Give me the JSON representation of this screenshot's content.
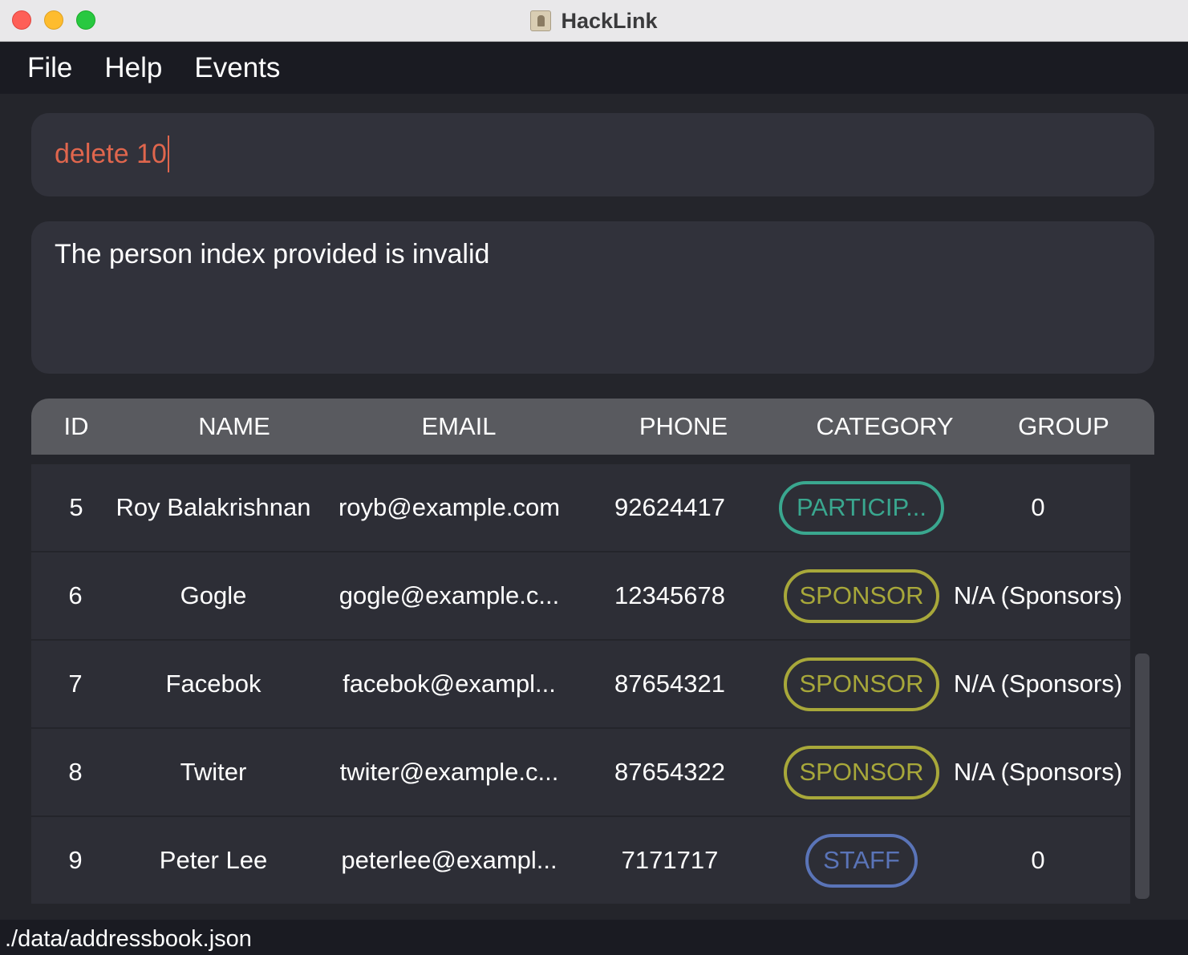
{
  "window": {
    "title": "HackLink",
    "app_icon": "contacts-book-icon"
  },
  "menubar": {
    "items": [
      "File",
      "Help",
      "Events"
    ]
  },
  "command": {
    "value": "delete 10"
  },
  "result": {
    "message": "The person index provided is invalid"
  },
  "table": {
    "columns": [
      "ID",
      "NAME",
      "EMAIL",
      "PHONE",
      "CATEGORY",
      "GROUP"
    ],
    "rows": [
      {
        "id": "5",
        "name": "Roy Balakrishnan",
        "email": "royb@example.com",
        "phone": "92624417",
        "category": "PARTICIP...",
        "category_type": "participant",
        "group": "0"
      },
      {
        "id": "6",
        "name": "Gogle",
        "email": "gogle@example.c...",
        "phone": "12345678",
        "category": "SPONSOR",
        "category_type": "sponsor",
        "group": "N/A (Sponsors)"
      },
      {
        "id": "7",
        "name": "Facebok",
        "email": "facebok@exampl...",
        "phone": "87654321",
        "category": "SPONSOR",
        "category_type": "sponsor",
        "group": "N/A (Sponsors)"
      },
      {
        "id": "8",
        "name": "Twiter",
        "email": "twiter@example.c...",
        "phone": "87654322",
        "category": "SPONSOR",
        "category_type": "sponsor",
        "group": "N/A (Sponsors)"
      },
      {
        "id": "9",
        "name": "Peter Lee",
        "email": "peterlee@exampl...",
        "phone": "7171717",
        "category": "STAFF",
        "category_type": "staff",
        "group": "0"
      }
    ]
  },
  "status": {
    "file_path": "./data/addressbook.json"
  },
  "colors": {
    "command_text": "#e0664d",
    "participant": "#3aa78f",
    "sponsor": "#a8a83a",
    "staff": "#5a74b8"
  }
}
